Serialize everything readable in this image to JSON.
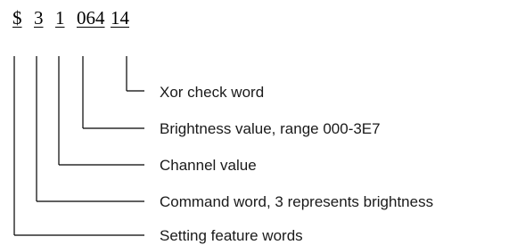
{
  "command": {
    "tokens": [
      {
        "id": "feature",
        "text": "$"
      },
      {
        "id": "command",
        "text": "3"
      },
      {
        "id": "channel",
        "text": "1"
      },
      {
        "id": "brightness",
        "text": "064"
      },
      {
        "id": "xor",
        "text": "14"
      }
    ]
  },
  "labels": {
    "xor": "Xor check word",
    "brightness": "Brightness value, range 000-3E7",
    "channel": "Channel value",
    "command": "Command word, 3 represents brightness",
    "feature": "Setting feature words"
  }
}
